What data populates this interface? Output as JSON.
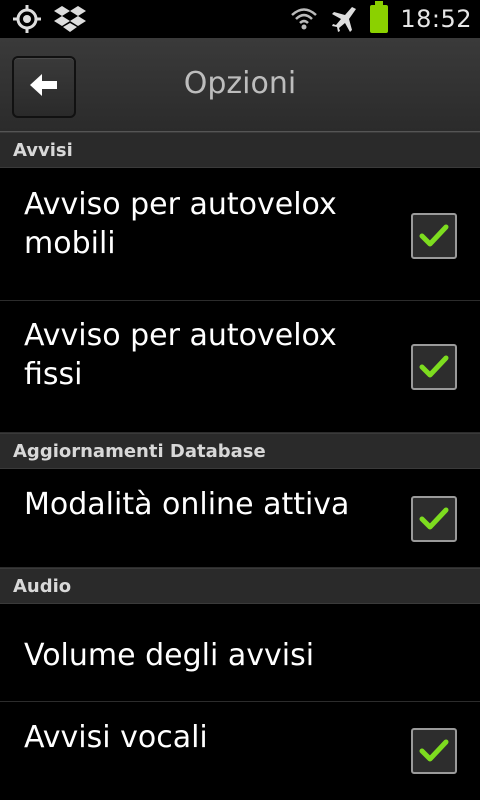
{
  "status_bar": {
    "left_icons": [
      "location-target-icon",
      "dropbox-icon"
    ],
    "right_icons": [
      "wifi-icon",
      "airplane-icon",
      "battery-icon"
    ],
    "time": "18:52",
    "battery_color": "#8bd100"
  },
  "action_bar": {
    "back_icon": "back-arrow-icon",
    "title": "Opzioni"
  },
  "sections": [
    {
      "header": "Avvisi",
      "items": [
        {
          "label": "Avviso per autovelox mobili",
          "checked": true
        },
        {
          "label": "Avviso per autovelox fissi",
          "checked": true
        }
      ]
    },
    {
      "header": "Aggiornamenti Database",
      "items": [
        {
          "label": "Modalità online attiva",
          "checked": true
        }
      ]
    },
    {
      "header": "Audio",
      "items": [
        {
          "label": "Volume degli avvisi"
        },
        {
          "label": "Avvisi vocali",
          "checked": true
        }
      ]
    }
  ],
  "colors": {
    "check": "#7ddc1f",
    "background": "#000000",
    "section_bg": "#2a2a2a"
  }
}
